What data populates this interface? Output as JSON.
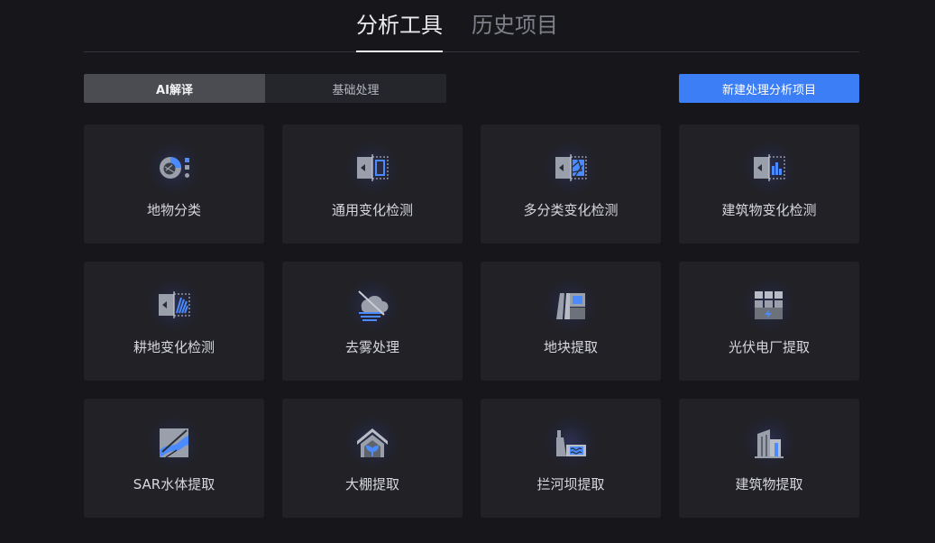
{
  "header": {
    "tabs": [
      {
        "label": "分析工具",
        "active": true
      },
      {
        "label": "历史项目",
        "active": false
      }
    ]
  },
  "toolbar": {
    "segments": [
      {
        "label": "AI解译",
        "active": true
      },
      {
        "label": "基础处理",
        "active": false
      }
    ],
    "new_project_label": "新建处理分析项目"
  },
  "colors": {
    "accent": "#3b7ef6",
    "background": "#17171b",
    "card": "#212126"
  },
  "tools": [
    {
      "label": "地物分类",
      "icon": "land-classification-icon"
    },
    {
      "label": "通用变化检测",
      "icon": "general-change-detection-icon"
    },
    {
      "label": "多分类变化检测",
      "icon": "multi-class-change-detection-icon"
    },
    {
      "label": "建筑物变化检测",
      "icon": "building-change-detection-icon"
    },
    {
      "label": "耕地变化检测",
      "icon": "farmland-change-detection-icon"
    },
    {
      "label": "去雾处理",
      "icon": "dehaze-icon"
    },
    {
      "label": "地块提取",
      "icon": "parcel-extraction-icon"
    },
    {
      "label": "光伏电厂提取",
      "icon": "solar-plant-icon"
    },
    {
      "label": "SAR水体提取",
      "icon": "sar-water-icon"
    },
    {
      "label": "大棚提取",
      "icon": "greenhouse-icon"
    },
    {
      "label": "拦河坝提取",
      "icon": "dam-icon"
    },
    {
      "label": "建筑物提取",
      "icon": "building-extraction-icon"
    }
  ]
}
